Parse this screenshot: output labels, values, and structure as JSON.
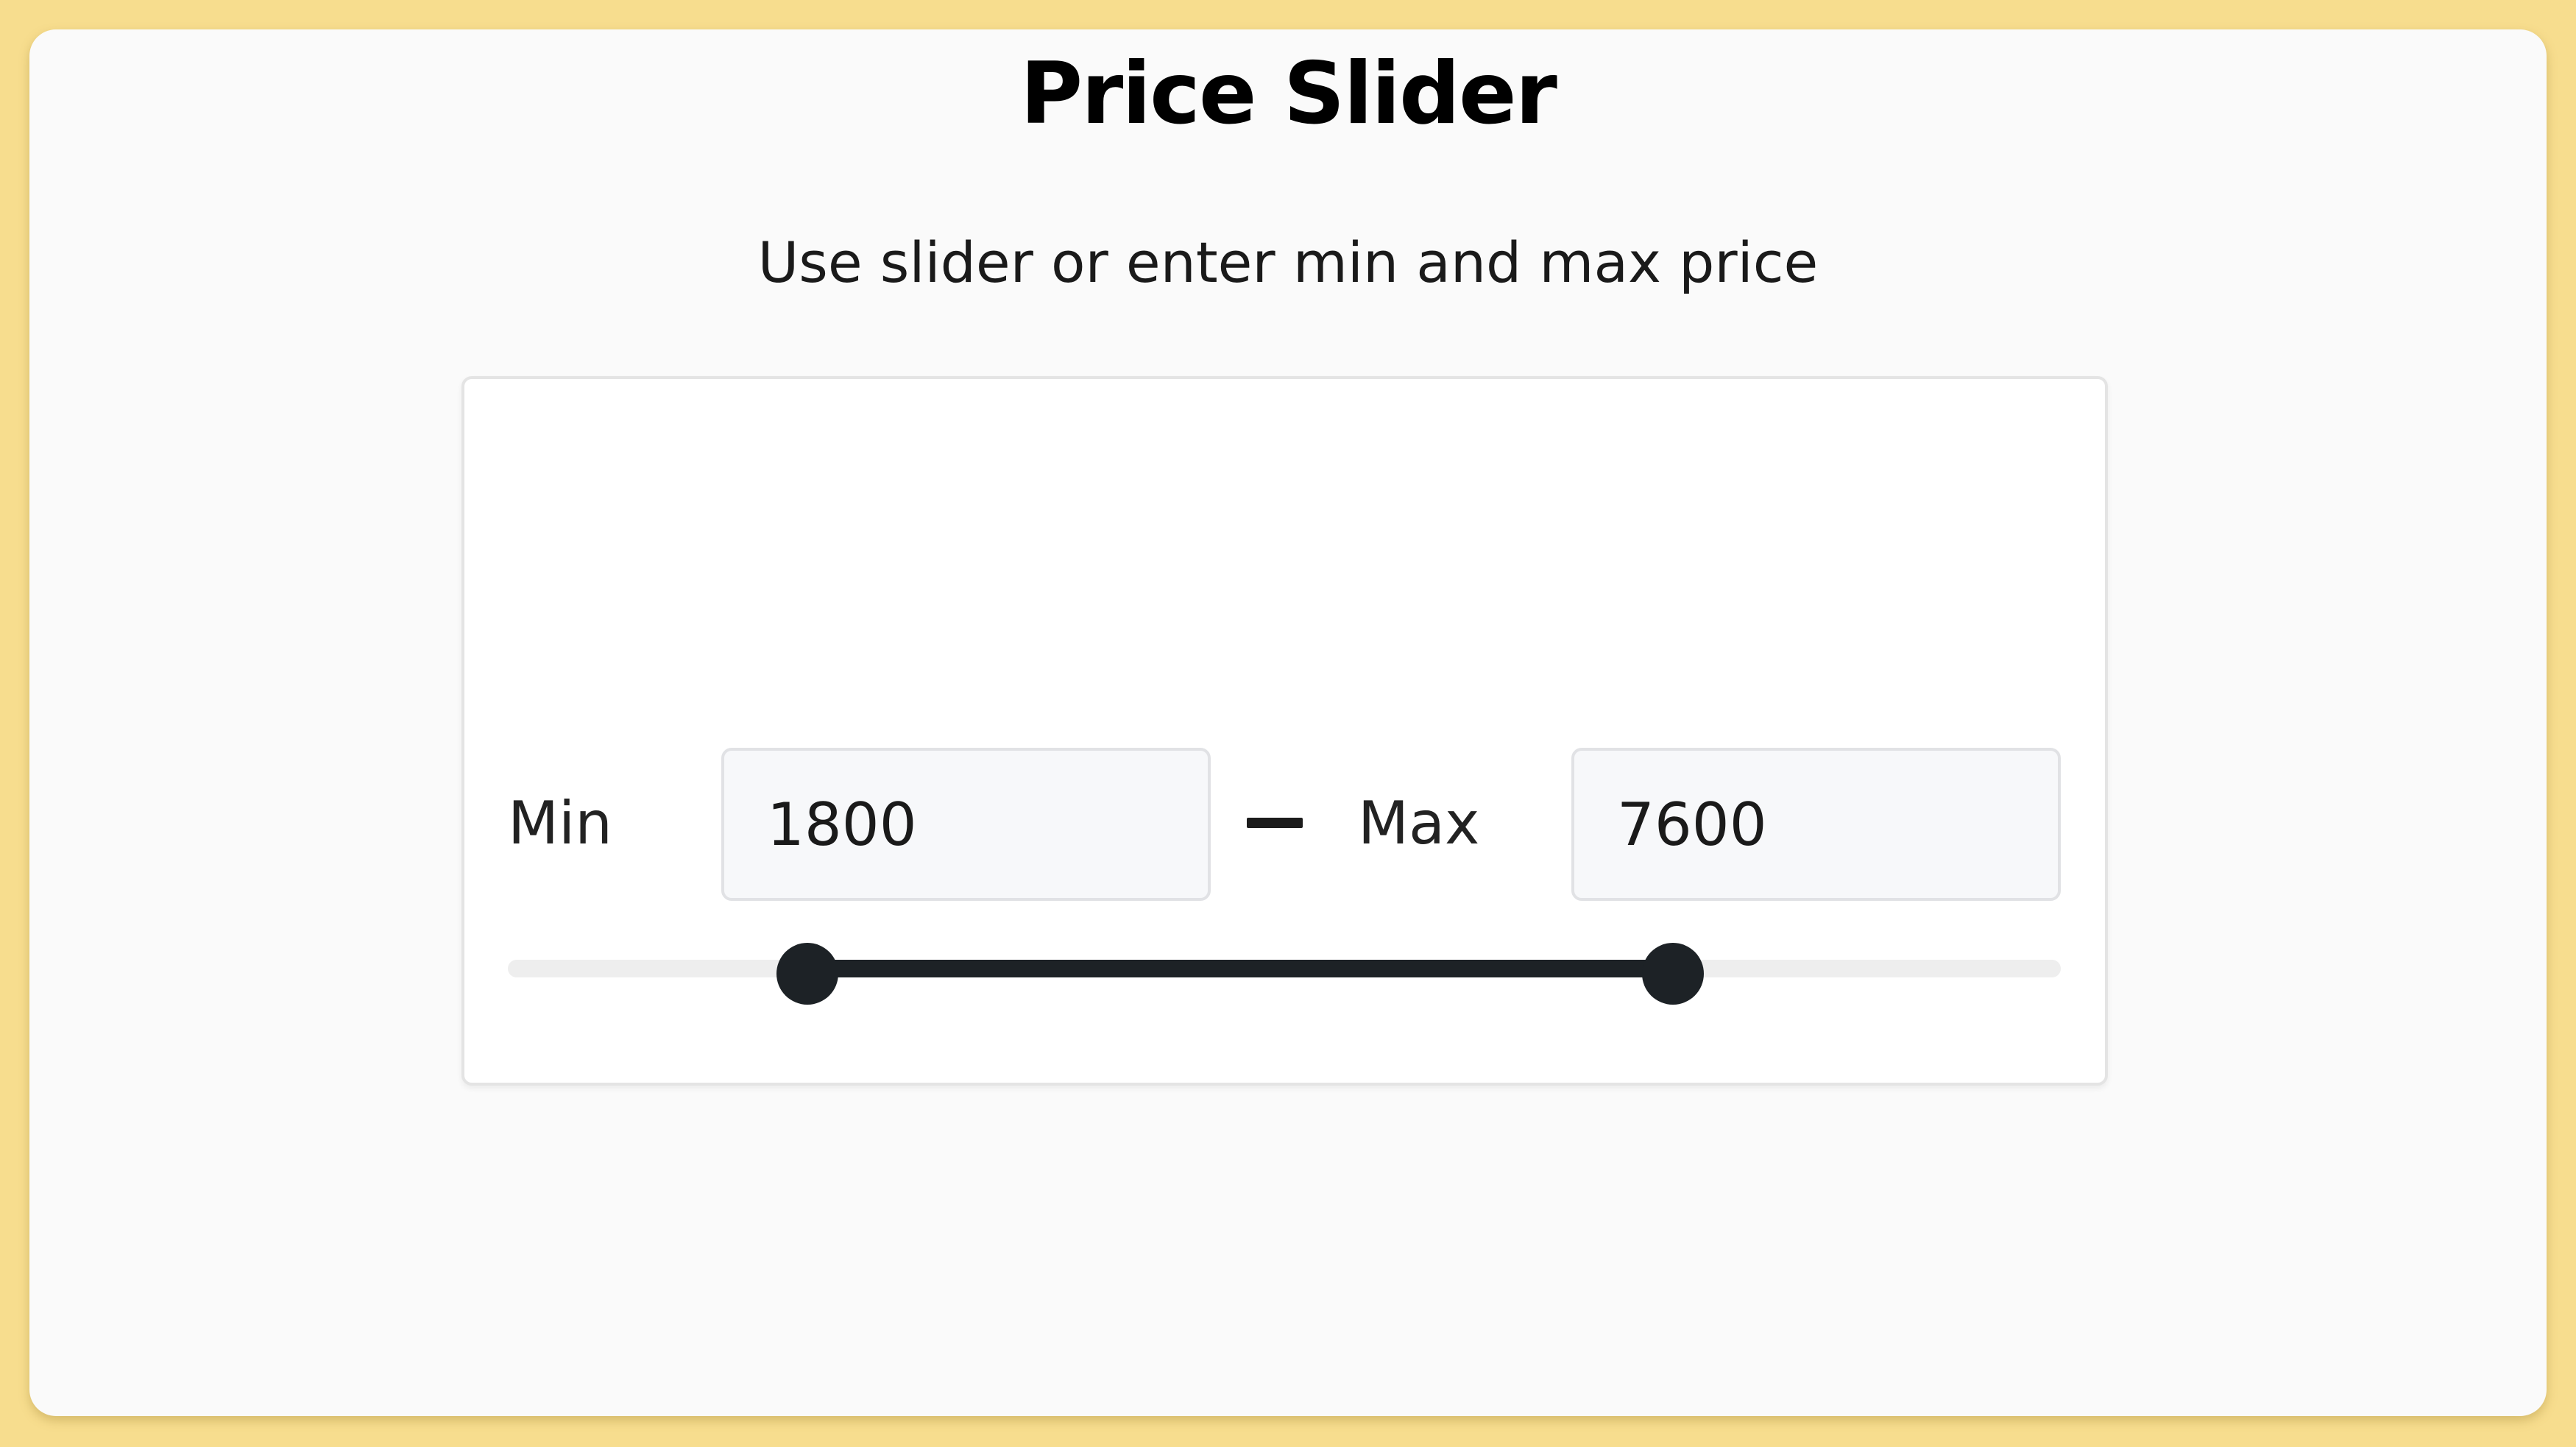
{
  "price_slider": {
    "title": "Price Slider",
    "subtitle": "Use slider or enter min and max price",
    "min_label": "Min",
    "max_label": "Max",
    "min_value": "1800",
    "max_value": "7600",
    "separator_icon": "dash-icon",
    "range_fraction": {
      "low": 0.193,
      "high": 0.75
    },
    "colors": {
      "page_background": "#f7dd8e",
      "slider_accent": "#1d2226",
      "track": "#eeeeee"
    }
  }
}
